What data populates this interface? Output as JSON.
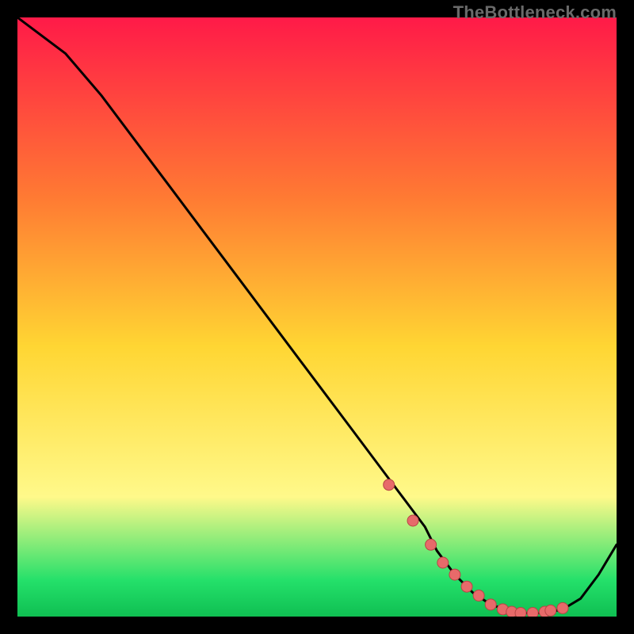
{
  "watermark": {
    "text": "TheBottleneck.com"
  },
  "colors": {
    "gradient_top": "#ff1a48",
    "gradient_upper": "#ff7a33",
    "gradient_mid": "#ffd633",
    "gradient_lower": "#fff98a",
    "gradient_green": "#24e06a",
    "gradient_dkgrn": "#0fbf52",
    "line": "#000000",
    "marker_fill": "#e76a6a",
    "marker_stroke": "#b74545"
  },
  "chart_data": {
    "type": "line",
    "title": "",
    "xlabel": "",
    "ylabel": "",
    "xlim": [
      0,
      100
    ],
    "ylim": [
      0,
      100
    ],
    "series": [
      {
        "name": "curve",
        "x": [
          0,
          8,
          14,
          20,
          26,
          32,
          38,
          44,
          50,
          56,
          62,
          68,
          70,
          73,
          76,
          79,
          82,
          85,
          88,
          91,
          94,
          97,
          100
        ],
        "y": [
          100,
          94,
          87,
          79,
          71,
          63,
          55,
          47,
          39,
          31,
          23,
          15,
          11,
          7,
          4,
          2,
          1.0,
          0.6,
          0.6,
          1.2,
          3,
          7,
          12
        ]
      }
    ],
    "markers": {
      "name": "highlight-points",
      "x": [
        62,
        66,
        69,
        71,
        73,
        75,
        77,
        79,
        81,
        82.5,
        84,
        86,
        88,
        89,
        91
      ],
      "y": [
        22,
        16,
        12,
        9,
        7,
        5,
        3.5,
        2,
        1.2,
        0.8,
        0.6,
        0.6,
        0.8,
        1.0,
        1.4
      ]
    }
  }
}
